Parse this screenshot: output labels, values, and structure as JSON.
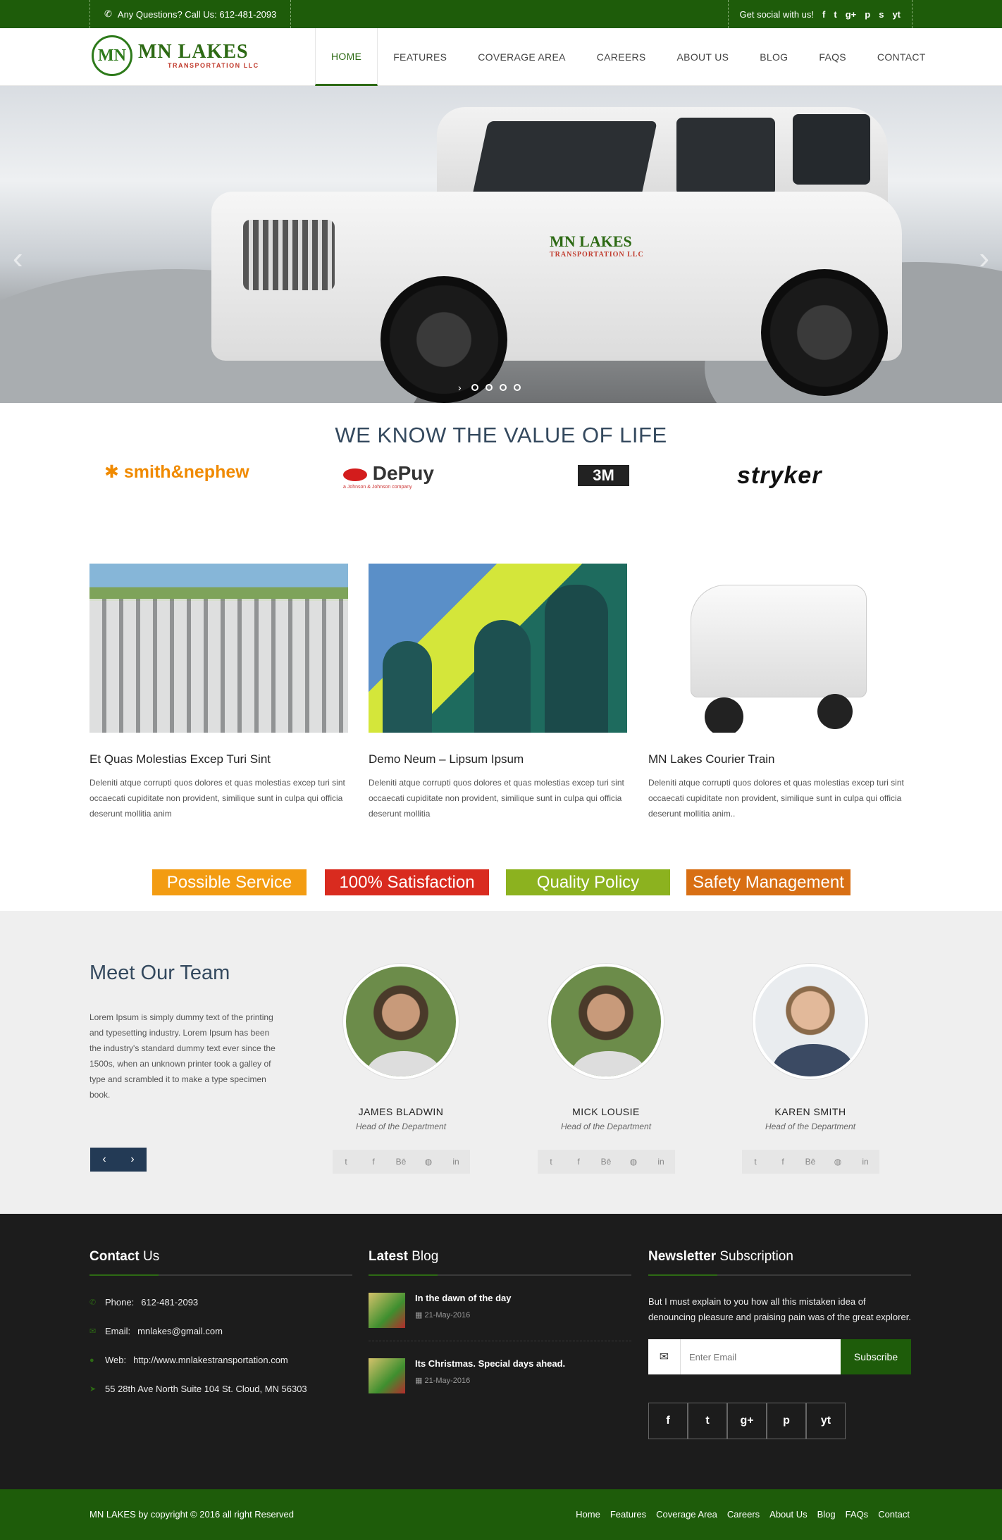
{
  "topbar": {
    "question": "Any Questions? Call Us: 612-481-2093",
    "social_label": "Get social with us!",
    "social_icons": [
      "f",
      "t",
      "g+",
      "p",
      "s",
      "yt"
    ]
  },
  "logo": {
    "name": "MN LAKES",
    "sub": "TRANSPORTATION LLC",
    "mark": "MN"
  },
  "nav": [
    "HOME",
    "FEATURES",
    "COVERAGE AREA",
    "CAREERS",
    "ABOUT US",
    "BLOG",
    "FAQS",
    "CONTACT"
  ],
  "hero": {
    "vehicle_logo": "MN LAKES",
    "vehicle_sub": "TRANSPORTATION LLC"
  },
  "value": {
    "heading": "WE KNOW THE VALUE OF LIFE",
    "brands": [
      "smith&nephew",
      "DePuy",
      "3M",
      "stryker"
    ],
    "depuy_sub": "a Johnson & Johnson company"
  },
  "services": [
    {
      "title": "Et Quas Molestias Excep Turi Sint",
      "text": "Deleniti atque corrupti quos dolores et quas molestias excep turi sint occaecati cupiditate non provident, similique sunt in culpa qui officia deserunt mollitia anim"
    },
    {
      "title": "Demo Neum – Lipsum Ipsum",
      "text": "Deleniti atque corrupti quos dolores et quas molestias excep turi sint occaecati cupiditate non provident, similique sunt in culpa qui officia deserunt mollitia"
    },
    {
      "title": "MN Lakes Courier Train",
      "text": "Deleniti atque corrupti quos dolores et quas molestias excep turi sint occaecati cupiditate non provident, similique sunt in culpa qui officia deserunt mollitia anim.."
    }
  ],
  "badges": [
    {
      "label": "Possible Service",
      "color": "#f39c12"
    },
    {
      "label": "100% Satisfaction",
      "color": "#d92b1f"
    },
    {
      "label": "Quality Policy",
      "color": "#8cb21f"
    },
    {
      "label": "Safety Management",
      "color": "#d86f14"
    }
  ],
  "team": {
    "heading": "Meet Our Team",
    "intro": "Lorem Ipsum is simply dummy text of the printing and typesetting industry. Lorem Ipsum has been the industry's standard dummy text ever since the 1500s, when an unknown printer took a galley of type and scrambled it to make a type specimen book.",
    "prev": "‹",
    "next": "›",
    "members": [
      {
        "name": "JAMES BLADWIN",
        "role": "Head of the Department"
      },
      {
        "name": "MICK LOUSIE",
        "role": "Head of the Department"
      },
      {
        "name": "KAREN SMITH",
        "role": "Head of the Department"
      }
    ],
    "social": [
      "t",
      "f",
      "Bē",
      "◍",
      "in"
    ]
  },
  "footer": {
    "contact_title_bold": "Contact",
    "contact_title_rest": " Us",
    "phone_label": "Phone:",
    "phone": "612-481-2093",
    "email_label": "Email:",
    "email": "mnlakes@gmail.com",
    "web_label": "Web:",
    "web": "http://www.mnlakestransportation.com",
    "address": "55 28th Ave North Suite 104 St. Cloud, MN 56303",
    "blog_title_bold": "Latest",
    "blog_title_rest": " Blog",
    "posts": [
      {
        "title": "In the dawn of the day",
        "date": "21-May-2016"
      },
      {
        "title": "Its Christmas. Special days ahead.",
        "date": "21-May-2016"
      }
    ],
    "nl_title_bold": "Newsletter",
    "nl_title_rest": " Subscription",
    "nl_text": "But I must explain to you how all this mistaken idea of denouncing pleasure and praising pain was of the great explorer.",
    "nl_placeholder": "Enter Email",
    "nl_button": "Subscribe",
    "nl_social": [
      "f",
      "t",
      "g+",
      "p",
      "yt"
    ]
  },
  "bottom": {
    "copyright": "MN LAKES by copyright © 2016 all right Reserved",
    "links": [
      "Home",
      "Features",
      "Coverage Area",
      "Careers",
      "About Us",
      "Blog",
      "FAQs",
      "Contact"
    ]
  }
}
